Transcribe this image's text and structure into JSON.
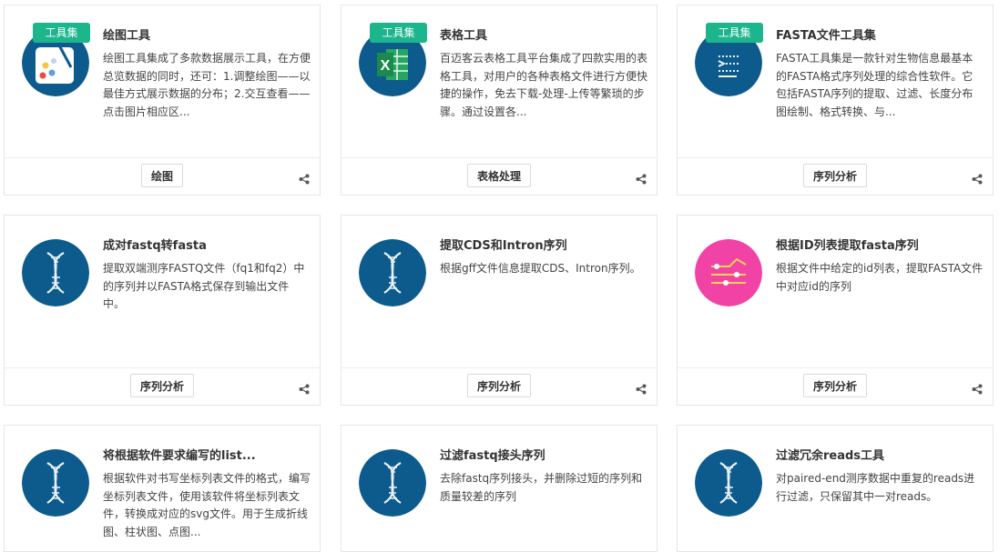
{
  "badge_label": "工具集",
  "cards": [
    {
      "icon": "palette-icon",
      "badge": true,
      "title": "绘图工具",
      "desc": "绘图工具集成了多款数据展示工具，在方便总览数据的同时，还可：1.调整绘图——以最佳方式展示数据的分布；2.交互查看——点击图片相应区...",
      "tag": "绘图"
    },
    {
      "icon": "spreadsheet-icon",
      "badge": true,
      "title": "表格工具",
      "desc": "百迈客云表格工具平台集成了四款实用的表格工具，对用户的各种表格文件进行方便快捷的操作，免去下载-处理-上传等繁琐的步骤。通过设置各...",
      "tag": "表格处理"
    },
    {
      "icon": "sequence-file-icon",
      "badge": true,
      "title": "FASTA文件工具集",
      "desc": "FASTA工具集是一款针对生物信息最基本的FASTA格式序列处理的综合性软件。它包括FASTA序列的提取、过滤、长度分布图绘制、格式转换、与...",
      "tag": "序列分析"
    },
    {
      "icon": "dna-icon",
      "badge": false,
      "title": "成对fastq转fasta",
      "desc": "提取双端测序FASTQ文件（fq1和fq2）中的序列并以FASTA格式保存到输出文件中。",
      "tag": "序列分析"
    },
    {
      "icon": "dna-icon",
      "badge": false,
      "title": "提取CDS和Intron序列",
      "desc": "根据gff文件信息提取CDS、Intron序列。",
      "tag": "序列分析"
    },
    {
      "icon": "list-filter-icon",
      "badge": false,
      "title": "根据ID列表提取fasta序列",
      "desc": "根据文件中给定的id列表，提取FASTA文件中对应id的序列",
      "tag": "序列分析"
    },
    {
      "icon": "dna-icon",
      "badge": false,
      "title": "将根据软件要求编写的list...",
      "desc": "根据软件对书写坐标列表文件的格式，编写坐标列表文件，使用该软件将坐标列表文件，转换成对应的svg文件。用于生成折线图、柱状图、点图...",
      "tag": ""
    },
    {
      "icon": "dna-icon",
      "badge": false,
      "title": "过滤fastq接头序列",
      "desc": "去除fastq序列接头，并删除过短的序列和质量较差的序列",
      "tag": ""
    },
    {
      "icon": "dna-icon",
      "badge": false,
      "title": "过滤冗余reads工具",
      "desc": "对paired-end测序数据中重复的reads进行过滤，只保留其中一对reads。",
      "tag": ""
    }
  ]
}
